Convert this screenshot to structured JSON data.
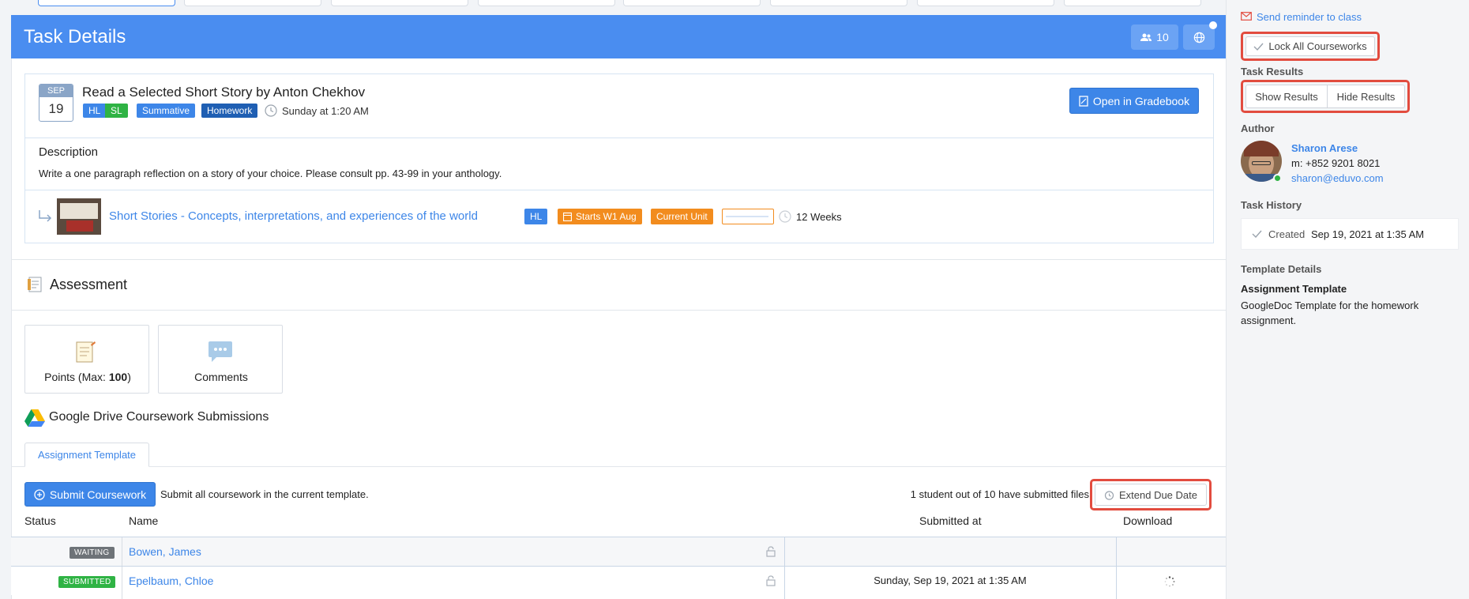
{
  "header": {
    "title": "Task Details",
    "students_count": "10"
  },
  "task": {
    "month": "SEP",
    "day": "19",
    "title": "Read a Selected Short Story by Anton Chekhov",
    "badges": {
      "hl": "HL",
      "sl": "SL",
      "summative": "Summative",
      "homework": "Homework"
    },
    "due": "Sunday at 1:20 AM",
    "gradebook_label": "Open in Gradebook",
    "description_heading": "Description",
    "description": "Write a one paragraph reflection on a story of your choice. Please consult pp. 43-99 in your anthology.",
    "unit": {
      "title": "Short Stories - Concepts, interpretations, and experiences of the world",
      "level": "HL",
      "starts": "Starts W1 Aug",
      "current": "Current Unit",
      "duration": "12 Weeks",
      "progress": 0
    }
  },
  "assessment": {
    "heading": "Assessment",
    "points_label": "Points (Max: ",
    "points_max": "100",
    "points_close": ")",
    "comments_label": "Comments"
  },
  "submissions": {
    "heading": "Google Drive Coursework Submissions",
    "tab": "Assignment Template",
    "submit_label": "Submit Coursework",
    "submit_hint": "Submit all coursework in the current template.",
    "summary": "1 student out of 10 have submitted files",
    "extend_label": "Extend Due Date",
    "columns": {
      "status": "Status",
      "name": "Name",
      "submitted_at": "Submitted at",
      "download": "Download"
    },
    "rows": [
      {
        "status": "WAITING",
        "name": "Bowen, James",
        "submitted_at": ""
      },
      {
        "status": "SUBMITTED",
        "name": "Epelbaum, Chloe",
        "submitted_at": "Sunday, Sep 19, 2021 at 1:35 AM"
      }
    ]
  },
  "sidebar": {
    "reminder": "Send reminder to class",
    "lock_label": "Lock All Courseworks",
    "results_heading": "Task Results",
    "show_results": "Show Results",
    "hide_results": "Hide Results",
    "author_heading": "Author",
    "author_name": "Sharon Arese",
    "author_phone": "m: +852 9201 8021",
    "author_email": "sharon@eduvo.com",
    "history_heading": "Task History",
    "history_created": "Created",
    "history_date": "Sep 19, 2021 at 1:35 AM",
    "template_heading": "Template Details",
    "template_name": "Assignment Template",
    "template_desc": "GoogleDoc Template for the homework assignment."
  },
  "colors": {
    "accent": "#4a8df0",
    "orange": "#f28c1e",
    "green": "#2fb344",
    "highlight": "#e24c3f"
  }
}
